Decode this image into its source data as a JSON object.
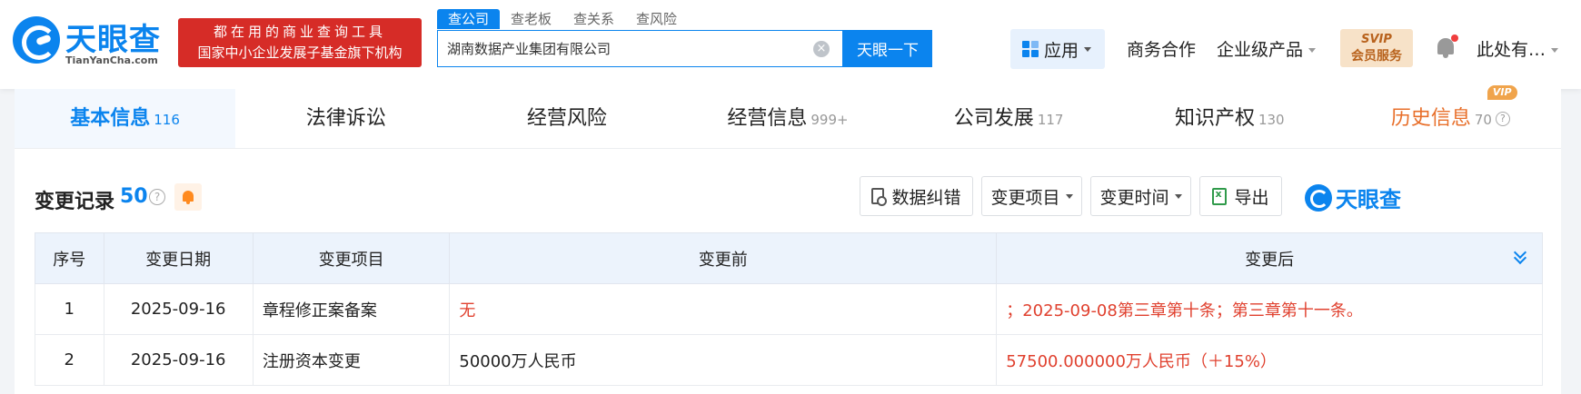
{
  "header": {
    "logo_name": "天眼查",
    "logo_sub": "TianYanCha.com",
    "banner_line1": "都在用的商业查询工具",
    "banner_line2": "国家中小企业发展子基金旗下机构",
    "search_tabs": [
      "查公司",
      "查老板",
      "查关系",
      "查风险"
    ],
    "search_value": "湖南数据产业集团有限公司",
    "clear_icon": "×",
    "search_button": "天眼一下",
    "app_label": "应用",
    "business_coop": "商务合作",
    "enterprise_products": "企业级产品",
    "svip_line1": "SVIP",
    "svip_line2": "会员服务",
    "user_name": "此处有…"
  },
  "tabs": [
    {
      "label": "基本信息",
      "count": "116"
    },
    {
      "label": "法律诉讼",
      "count": ""
    },
    {
      "label": "经营风险",
      "count": ""
    },
    {
      "label": "经营信息",
      "count": "999+"
    },
    {
      "label": "公司发展",
      "count": "117"
    },
    {
      "label": "知识产权",
      "count": "130"
    },
    {
      "label": "历史信息",
      "count": "70",
      "badge": "VIP"
    }
  ],
  "section": {
    "title": "变更记录",
    "count": "50",
    "help": "?",
    "buttons": {
      "correction": "数据纠错",
      "change_item": "变更项目",
      "change_time": "变更时间",
      "export": "导出"
    },
    "brand": "天眼查"
  },
  "table": {
    "headers": [
      "序号",
      "变更日期",
      "变更项目",
      "变更前",
      "变更后"
    ],
    "rows": [
      {
        "no": "1",
        "date": "2025-09-16",
        "item": "章程修正案备案",
        "before": "无",
        "after": "；2025-09-08第三章第十条；第三章第十一条。"
      },
      {
        "no": "2",
        "date": "2025-09-16",
        "item": "注册资本变更",
        "before": "50000万人民币",
        "after": "57500.000000万人民币（＋15%）"
      }
    ]
  },
  "colors": {
    "brand_blue": "#0b84ee",
    "highlight_red": "#e0412f",
    "banner_red": "#d62c27",
    "history_orange": "#e86f2a"
  }
}
